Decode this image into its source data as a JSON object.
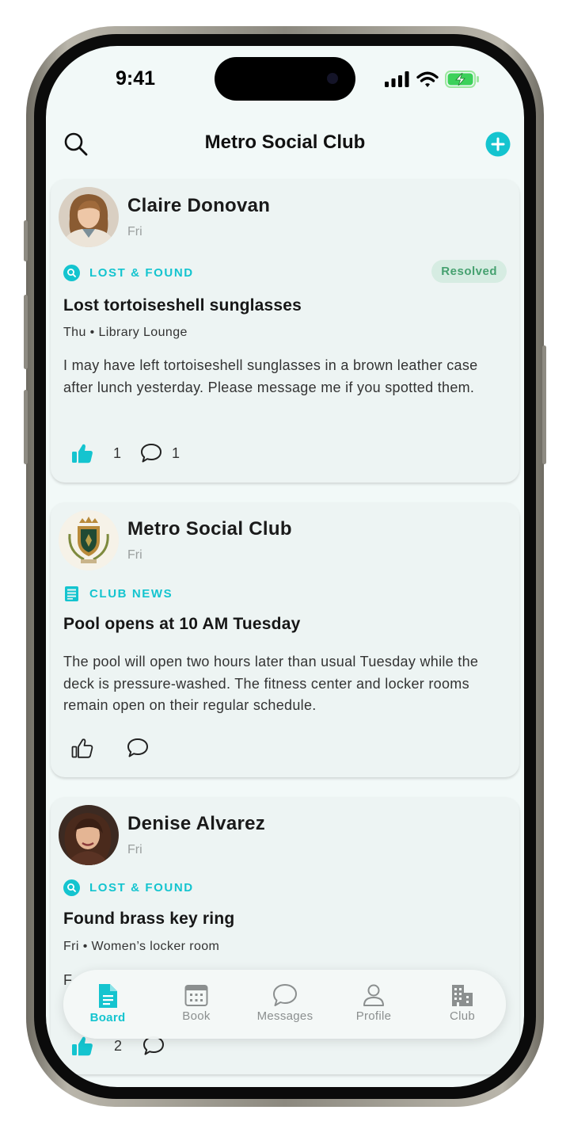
{
  "status_bar": {
    "time": "9:41"
  },
  "header": {
    "title": "Metro Social Club"
  },
  "posts": [
    {
      "author": "Claire Donovan",
      "day": "Fri",
      "category": "LOST & FOUND",
      "badge": "Resolved",
      "title": "Lost tortoiseshell sunglasses",
      "meta": "Thu • Library Lounge",
      "body": "I may have left tortoiseshell sunglasses in a brown leather case after lunch yesterday. Please message me if you spotted them.",
      "likes": "1",
      "comments": "1"
    },
    {
      "author": "Metro Social Club",
      "day": "Fri",
      "category": "CLUB NEWS",
      "title": "Pool opens at 10 AM Tuesday",
      "body": "The pool will open two hours later than usual Tuesday while the deck is pressure-washed. The fitness center and locker rooms remain open on their regular schedule."
    },
    {
      "author": "Denise Alvarez",
      "day": "Fri",
      "category": "LOST & FOUND",
      "title": "Found brass key ring",
      "meta": "Fri • Women’s locker room",
      "body_partial": "F",
      "likes": "2"
    }
  ],
  "tabs": [
    {
      "label": "Board",
      "icon": "document-icon",
      "active": true
    },
    {
      "label": "Book",
      "icon": "calendar-icon"
    },
    {
      "label": "Messages",
      "icon": "chat-bubble-icon"
    },
    {
      "label": "Profile",
      "icon": "person-icon"
    },
    {
      "label": "Club",
      "icon": "building-icon"
    }
  ],
  "colors": {
    "accent": "#14c4cf",
    "background": "#f2f9f8",
    "card": "#edf4f3",
    "resolved_bg": "#d6ece2",
    "resolved_text": "#46a170"
  }
}
